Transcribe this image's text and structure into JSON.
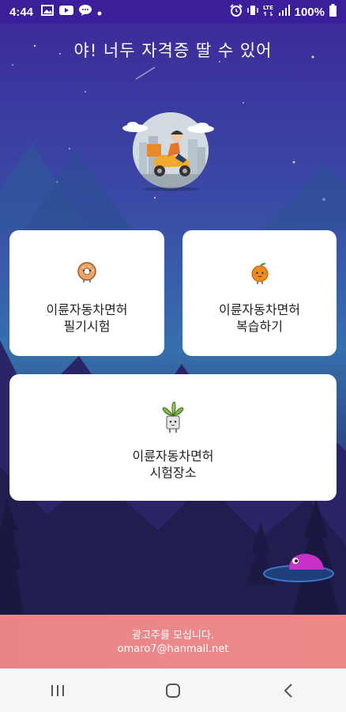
{
  "status_bar": {
    "time": "4:44",
    "battery": "100%",
    "left_icons": [
      "image-icon",
      "youtube-icon",
      "chat-icon",
      "dot-icon"
    ],
    "right_icons": [
      "alarm-icon",
      "vibrate-icon",
      "lte-icon",
      "signal-icon",
      "battery-icon"
    ]
  },
  "header": {
    "title": "야! 너두 자격증 딸 수 있어"
  },
  "menu": {
    "written_test": {
      "line1": "이륜자동차면허",
      "line2": "필기시험",
      "icon": "donut-icon"
    },
    "review": {
      "line1": "이륜자동차면허",
      "line2": "복습하기",
      "icon": "orange-icon"
    },
    "test_site": {
      "line1": "이륜자동차면허",
      "line2": "시험장소",
      "icon": "plant-icon"
    }
  },
  "ad": {
    "line1": "광고주를 모십니다.",
    "line2": "omaro7@hanmail.net"
  },
  "nav": [
    "recents-icon",
    "home-icon",
    "back-icon"
  ],
  "colors": {
    "status_bar": "#3b1e9a",
    "sky_top": "#3c2c9a",
    "sky_mid": "#3770ad",
    "ad_bar": "#e88589",
    "card": "#ffffff",
    "nav_bar": "#f6f6f6"
  }
}
